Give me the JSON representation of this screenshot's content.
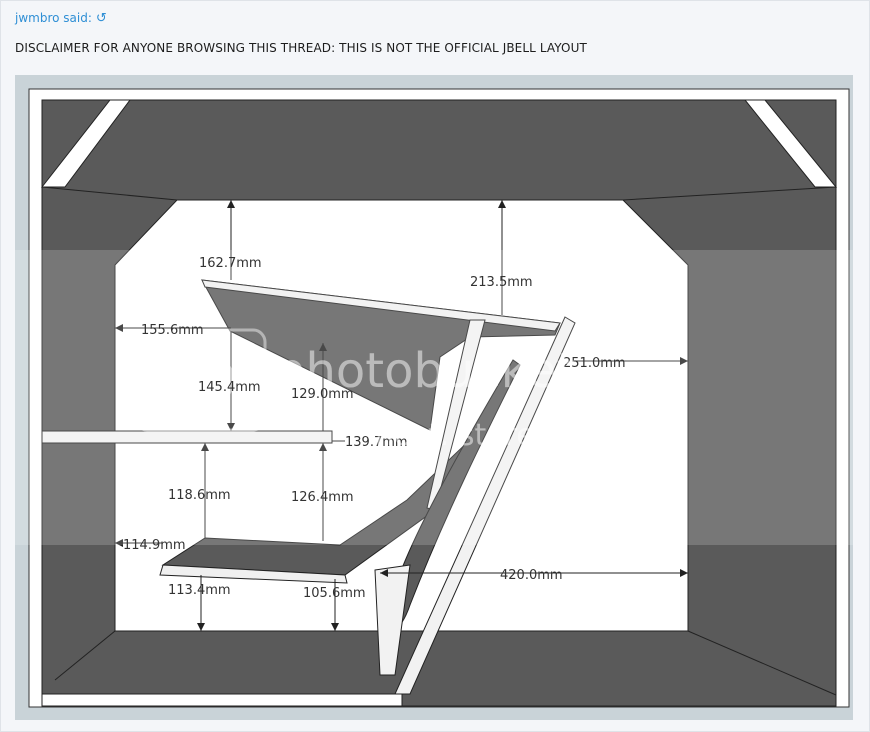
{
  "post": {
    "author_said": "jwmbro said:",
    "reply_icon": "reply-arrow-icon",
    "disclaimer": "DISCLAIMER FOR ANYONE BROWSING THIS THREAD: THIS IS NOT THE OFFICIAL JBELL LAYOUT"
  },
  "figure": {
    "dimensions": {
      "d1": "162.7mm",
      "d2": "213.5mm",
      "d3": "155.6mm",
      "d4": "251.0mm",
      "d5": "145.4mm",
      "d6": "129.0mm",
      "d7": "139.7mm",
      "d8": "118.6mm",
      "d9": "126.4mm",
      "d10": "114.9mm",
      "d11": "113.4mm",
      "d12": "105.6mm",
      "d13": "420.0mm"
    },
    "watermark": {
      "brand": "photobucket",
      "tagline": "host. store. share."
    }
  },
  "colors": {
    "link": "#2f8fd5",
    "panel": "#5b5b5b",
    "background": "#c9d3d8"
  }
}
